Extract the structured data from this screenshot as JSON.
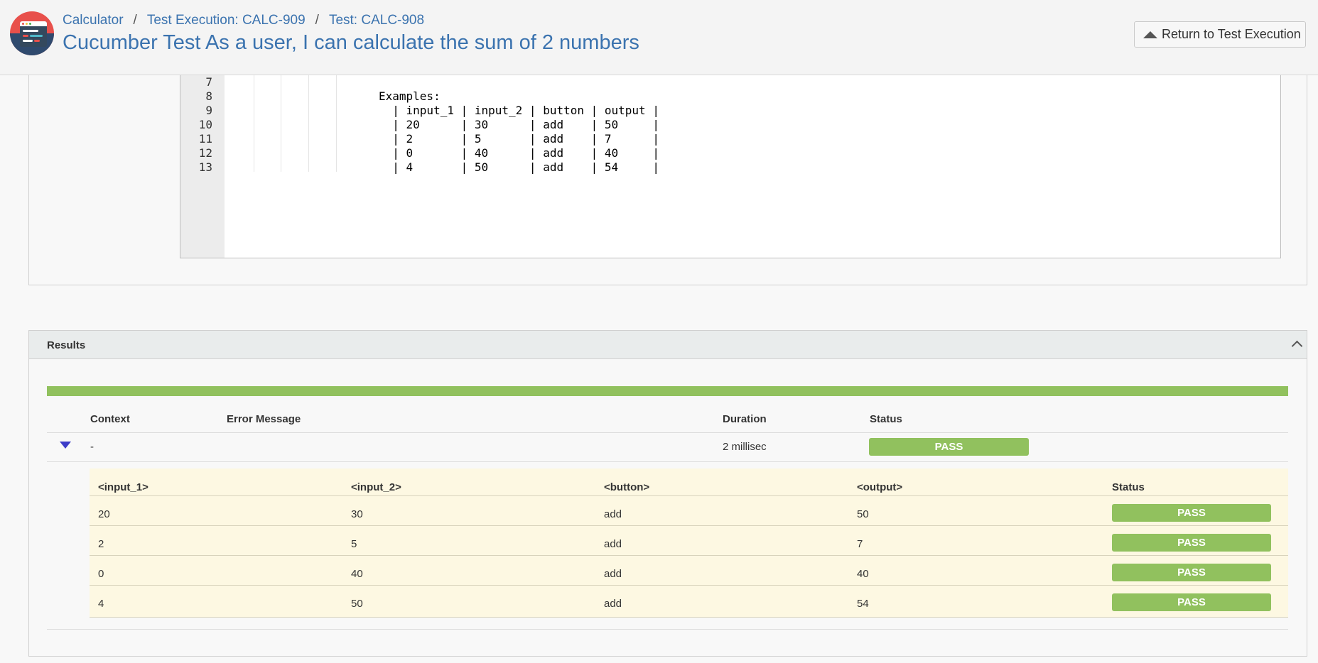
{
  "header": {
    "breadcrumbs": [
      "Calculator",
      "Test Execution: CALC-909",
      "Test: CALC-908"
    ],
    "breadcrumb_separator": "/",
    "title": "Cucumber Test As a user, I can calculate the sum of 2 numbers",
    "return_button": "Return to Test Execution"
  },
  "code": {
    "lines": [
      {
        "num": "7",
        "text": ""
      },
      {
        "num": "8",
        "text": "Examples:"
      },
      {
        "num": "9",
        "text": "  | input_1 | input_2 | button | output |"
      },
      {
        "num": "10",
        "text": "  | 20      | 30      | add    | 50     |"
      },
      {
        "num": "11",
        "text": "  | 2       | 5       | add    | 7      |"
      },
      {
        "num": "12",
        "text": "  | 0       | 40      | add    | 40     |"
      },
      {
        "num": "13",
        "text": "  | 4       | 50      | add    | 54     |"
      }
    ]
  },
  "results": {
    "title": "Results",
    "columns": {
      "context": "Context",
      "error": "Error Message",
      "duration": "Duration",
      "status": "Status"
    },
    "row": {
      "context": "-",
      "error": "",
      "duration": "2 millisec",
      "status": "PASS"
    },
    "examples": {
      "headers": [
        "<input_1>",
        "<input_2>",
        "<button>",
        "<output>",
        "Status"
      ],
      "rows": [
        [
          "20",
          "30",
          "add",
          "50",
          "PASS"
        ],
        [
          "2",
          "5",
          "add",
          "7",
          "PASS"
        ],
        [
          "0",
          "40",
          "add",
          "40",
          "PASS"
        ],
        [
          "4",
          "50",
          "add",
          "54",
          "PASS"
        ]
      ]
    }
  },
  "colors": {
    "pass": "#91c15e",
    "link": "#3b73af",
    "example_bg": "#fdf8e2"
  },
  "icons": {
    "logo": "xray-logo",
    "return": "triangle-up-icon",
    "collapse": "chevron-up-icon",
    "expand": "triangle-down-icon"
  }
}
